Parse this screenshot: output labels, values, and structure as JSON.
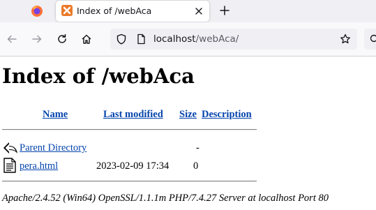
{
  "browser": {
    "tab": {
      "title": "Index of /webAca"
    },
    "address": {
      "host": "localhost",
      "path": "/webAca/"
    }
  },
  "page": {
    "title": "Index of /webAca",
    "columns": {
      "name": "Name",
      "last_modified": "Last modified",
      "size": "Size",
      "description": "Description"
    },
    "rows": [
      {
        "icon": "back-arrow-icon",
        "name": "Parent Directory",
        "last_modified": "",
        "size": "-",
        "description": ""
      },
      {
        "icon": "text-file-icon",
        "name": "pera.html",
        "last_modified": "2023-02-09 17:34",
        "size": "0",
        "description": ""
      }
    ],
    "footer": "Apache/2.4.52 (Win64) OpenSSL/1.1.1m PHP/7.4.27 Server at localhost Port 80"
  },
  "colors": {
    "link": "#0645ad",
    "chrome_bg": "#f0f0f4",
    "toolbar_bg": "#f9f9fb",
    "tab_favicon": "#ea7a28"
  }
}
